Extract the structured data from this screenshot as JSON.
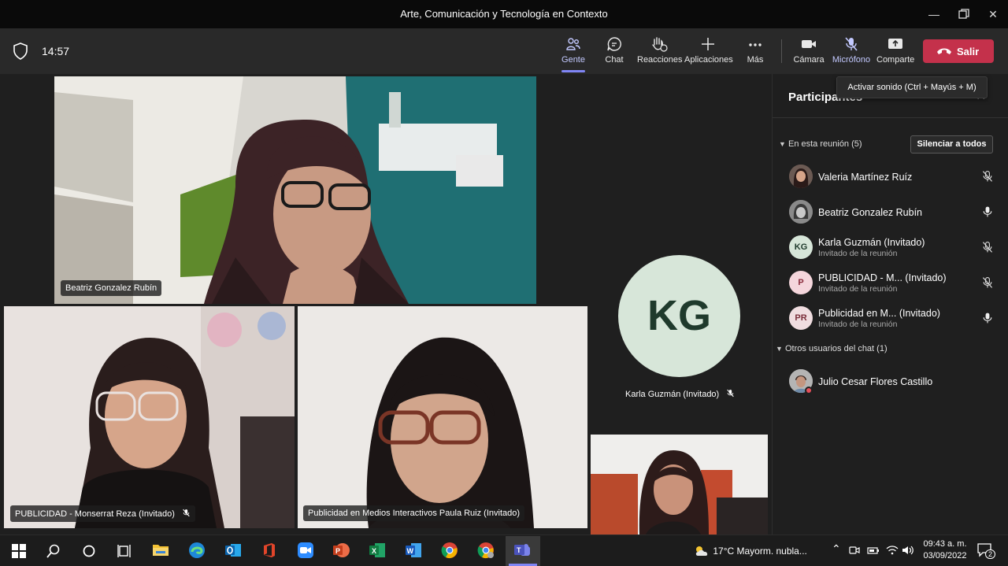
{
  "window": {
    "title": "Arte, Comunicación y Tecnología en Contexto"
  },
  "toolbar": {
    "time": "14:57",
    "buttons": [
      {
        "label": "Gente",
        "icon": "people-icon"
      },
      {
        "label": "Chat",
        "icon": "chat-icon"
      },
      {
        "label": "Reacciones",
        "icon": "raise-hand-icon"
      },
      {
        "label": "Aplicaciones",
        "icon": "plus-icon"
      },
      {
        "label": "Más",
        "icon": "more-icon"
      },
      {
        "label": "Cámara",
        "icon": "camera-icon"
      },
      {
        "label": "Micrófono",
        "icon": "mic-off-icon"
      },
      {
        "label": "Comparte",
        "icon": "share-icon"
      }
    ],
    "leave_label": "Salir",
    "mic_tooltip": "Activar sonido (Ctrl + Mayús + M)"
  },
  "stage": {
    "tiles": [
      {
        "name": "Beatriz Gonzalez Rubín"
      },
      {
        "name": "PUBLICIDAD - Monserrat Reza (Invitado)"
      },
      {
        "name": "Publicidad en Medios Interactivos Paula Ruiz (Invitado)"
      }
    ],
    "avatar_tile": {
      "initials": "KG",
      "name": "Karla Guzmán (Invitado)"
    }
  },
  "panel": {
    "title": "Participantes",
    "in_meeting_label": "En esta reunión (5)",
    "mute_all_label": "Silenciar a todos",
    "participants": [
      {
        "name": "Valeria Martínez Ruíz",
        "sub": "",
        "avatar": "",
        "mic": "muted"
      },
      {
        "name": "Beatriz Gonzalez Rubín",
        "sub": "",
        "avatar": "",
        "mic": "on"
      },
      {
        "name": "Karla Guzmán (Invitado)",
        "sub": "Invitado de la reunión",
        "avatar": "KG",
        "mic": "muted"
      },
      {
        "name": "PUBLICIDAD - M...  (Invitado)",
        "sub": "Invitado de la reunión",
        "avatar": "P",
        "mic": "muted"
      },
      {
        "name": "Publicidad en M...  (Invitado)",
        "sub": "Invitado de la reunión",
        "avatar": "PR",
        "mic": "on"
      }
    ],
    "others_label": "Otros usuarios del chat (1)",
    "others": [
      {
        "name": "Julio Cesar Flores Castillo"
      }
    ]
  },
  "taskbar": {
    "weather": "17°C  Mayorm. nubla...",
    "time": "09:43 a. m.",
    "date": "03/09/2022",
    "notifications": "2"
  },
  "colors": {
    "accent": "#7f85f5",
    "leave": "#c4314b",
    "bg": "#1f1f1f"
  }
}
